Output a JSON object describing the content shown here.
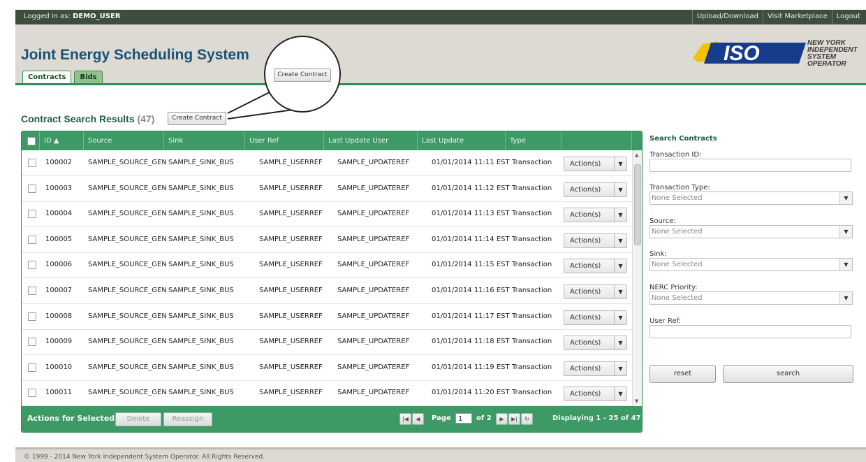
{
  "topbar": {
    "login_prefix": "Logged in as:",
    "username": "DEMO_USER",
    "links": [
      "Upload/Download",
      "Visit Marketplace",
      "Logout"
    ]
  },
  "header": {
    "title": "Joint Energy Scheduling System",
    "tabs": [
      "Contracts",
      "Bids"
    ],
    "active_tab": "Contracts"
  },
  "logo": {
    "mark": "ISO",
    "line1": "NEW YORK",
    "line2": "INDEPENDENT",
    "line3": "SYSTEM OPERATOR"
  },
  "callout": {
    "button_label": "Create Contract"
  },
  "results": {
    "title": "Contract Search Results",
    "count": "(47)",
    "create_button": "Create Contract"
  },
  "grid": {
    "columns": [
      "ID ▲",
      "Source",
      "Sink",
      "User Ref",
      "Last Update User",
      "Last Update",
      "Type",
      ""
    ],
    "action_label": "Action(s)",
    "rows": [
      {
        "id": "100002",
        "source": "SAMPLE_SOURCE_GEN",
        "sink": "SAMPLE_SINK_BUS",
        "user_ref": "SAMPLE_USERREF",
        "update_user": "SAMPLE_UPDATEREF",
        "last_update": "01/01/2014 11:11 EST",
        "type": "Transaction"
      },
      {
        "id": "100003",
        "source": "SAMPLE_SOURCE_GEN",
        "sink": "SAMPLE_SINK_BUS",
        "user_ref": "SAMPLE_USERREF",
        "update_user": "SAMPLE_UPDATEREF",
        "last_update": "01/01/2014 11:12 EST",
        "type": "Transaction"
      },
      {
        "id": "100004",
        "source": "SAMPLE_SOURCE_GEN",
        "sink": "SAMPLE_SINK_BUS",
        "user_ref": "SAMPLE_USERREF",
        "update_user": "SAMPLE_UPDATEREF",
        "last_update": "01/01/2014 11:13 EST",
        "type": "Transaction"
      },
      {
        "id": "100005",
        "source": "SAMPLE_SOURCE_GEN",
        "sink": "SAMPLE_SINK_BUS",
        "user_ref": "SAMPLE_USERREF",
        "update_user": "SAMPLE_UPDATEREF",
        "last_update": "01/01/2014 11:14 EST",
        "type": "Transaction"
      },
      {
        "id": "100006",
        "source": "SAMPLE_SOURCE_GEN",
        "sink": "SAMPLE_SINK_BUS",
        "user_ref": "SAMPLE_USERREF",
        "update_user": "SAMPLE_UPDATEREF",
        "last_update": "01/01/2014 11:15 EST",
        "type": "Transaction"
      },
      {
        "id": "100007",
        "source": "SAMPLE_SOURCE_GEN",
        "sink": "SAMPLE_SINK_BUS",
        "user_ref": "SAMPLE_USERREF",
        "update_user": "SAMPLE_UPDATEREF",
        "last_update": "01/01/2014 11:16 EST",
        "type": "Transaction"
      },
      {
        "id": "100008",
        "source": "SAMPLE_SOURCE_GEN",
        "sink": "SAMPLE_SINK_BUS",
        "user_ref": "SAMPLE_USERREF",
        "update_user": "SAMPLE_UPDATEREF",
        "last_update": "01/01/2014 11:17 EST",
        "type": "Transaction"
      },
      {
        "id": "100009",
        "source": "SAMPLE_SOURCE_GEN",
        "sink": "SAMPLE_SINK_BUS",
        "user_ref": "SAMPLE_USERREF",
        "update_user": "SAMPLE_UPDATEREF",
        "last_update": "01/01/2014 11:18 EST",
        "type": "Transaction"
      },
      {
        "id": "100010",
        "source": "SAMPLE_SOURCE_GEN",
        "sink": "SAMPLE_SINK_BUS",
        "user_ref": "SAMPLE_USERREF",
        "update_user": "SAMPLE_UPDATEREF",
        "last_update": "01/01/2014 11:19 EST",
        "type": "Transaction"
      },
      {
        "id": "100011",
        "source": "SAMPLE_SOURCE_GEN",
        "sink": "SAMPLE_SINK_BUS",
        "user_ref": "SAMPLE_USERREF",
        "update_user": "SAMPLE_UPDATEREF",
        "last_update": "01/01/2014 11:20 EST",
        "type": "Transaction"
      }
    ],
    "footer": {
      "actions_label": "Actions for Selected:",
      "delete_label": "Delete",
      "reassign_label": "Reassign",
      "page_label": "Page",
      "page_value": "1",
      "of_label": "of 2",
      "displaying": "Displaying 1 - 25 of 47"
    }
  },
  "search": {
    "title": "Search Contracts",
    "transaction_id_label": "Transaction ID:",
    "transaction_type_label": "Transaction Type:",
    "source_label": "Source:",
    "sink_label": "Sink:",
    "nerc_label": "NERC Priority:",
    "user_ref_label": "User Ref:",
    "none_selected": "None Selected",
    "reset_label": "reset",
    "search_label": "search"
  },
  "footer": {
    "copyright": "© 1999 - 2014 New York Independent System Operator. All Rights Reserved."
  },
  "colors": {
    "header_green": "#3d9a66",
    "title_blue": "#1a5276",
    "logo_yellow": "#f2c100",
    "logo_blue": "#173c8c"
  }
}
